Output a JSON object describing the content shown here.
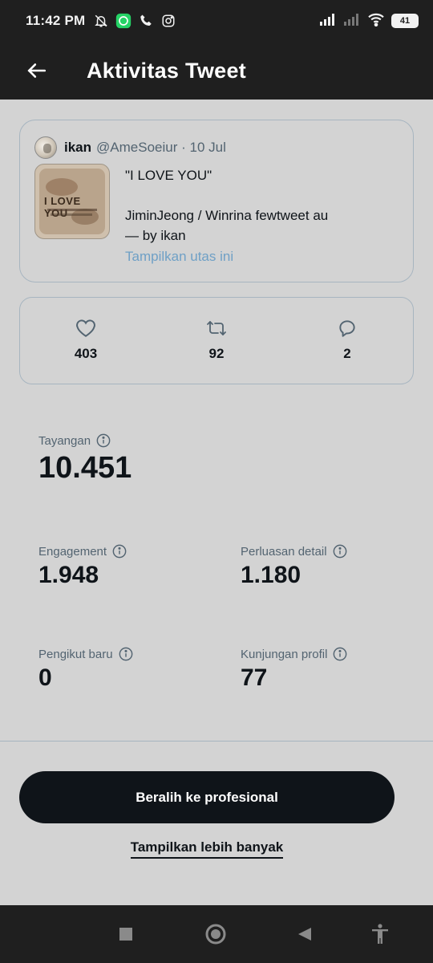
{
  "status_bar": {
    "time": "11:42 PM",
    "battery": "41",
    "left_icons": [
      "mute-bell-icon",
      "whatsapp-icon",
      "phone-call-icon",
      "instagram-icon"
    ],
    "right_icons": [
      "cell-signal-icon",
      "cell-signal-weak-icon",
      "wifi-icon",
      "battery-icon"
    ]
  },
  "header": {
    "title": "Aktivitas Tweet",
    "back_icon": "arrow-left-icon"
  },
  "tweet": {
    "author_name": "ikan",
    "author_handle_date": "@AmeSoeiur · 10 Jul",
    "thumb_text": "I LOVE YOU",
    "line1": "\"I LOVE YOU\"",
    "line2": "JiminJeong / Winrina fewtweet au",
    "line3": "— by ikan",
    "show_thread": "Tampilkan utas ini"
  },
  "engagement": {
    "likes": "403",
    "retweets": "92",
    "replies": "2"
  },
  "metrics": {
    "impressions_label": "Tayangan",
    "impressions_value": "10.451",
    "engagement_label": "Engagement",
    "engagement_value": "1.948",
    "detail_expands_label": "Perluasan detail",
    "detail_expands_value": "1.180",
    "new_followers_label": "Pengikut baru",
    "new_followers_value": "0",
    "profile_visits_label": "Kunjungan profil",
    "profile_visits_value": "77"
  },
  "actions": {
    "go_pro": "Beralih ke profesional",
    "show_more": "Tampilkan lebih banyak"
  },
  "colors": {
    "background": "#d3d3d3",
    "dark_bar": "#1f1f1f",
    "link_blue": "#6fa0c6",
    "card_border": "#a7b5c0",
    "button_bg": "#0f1419"
  }
}
